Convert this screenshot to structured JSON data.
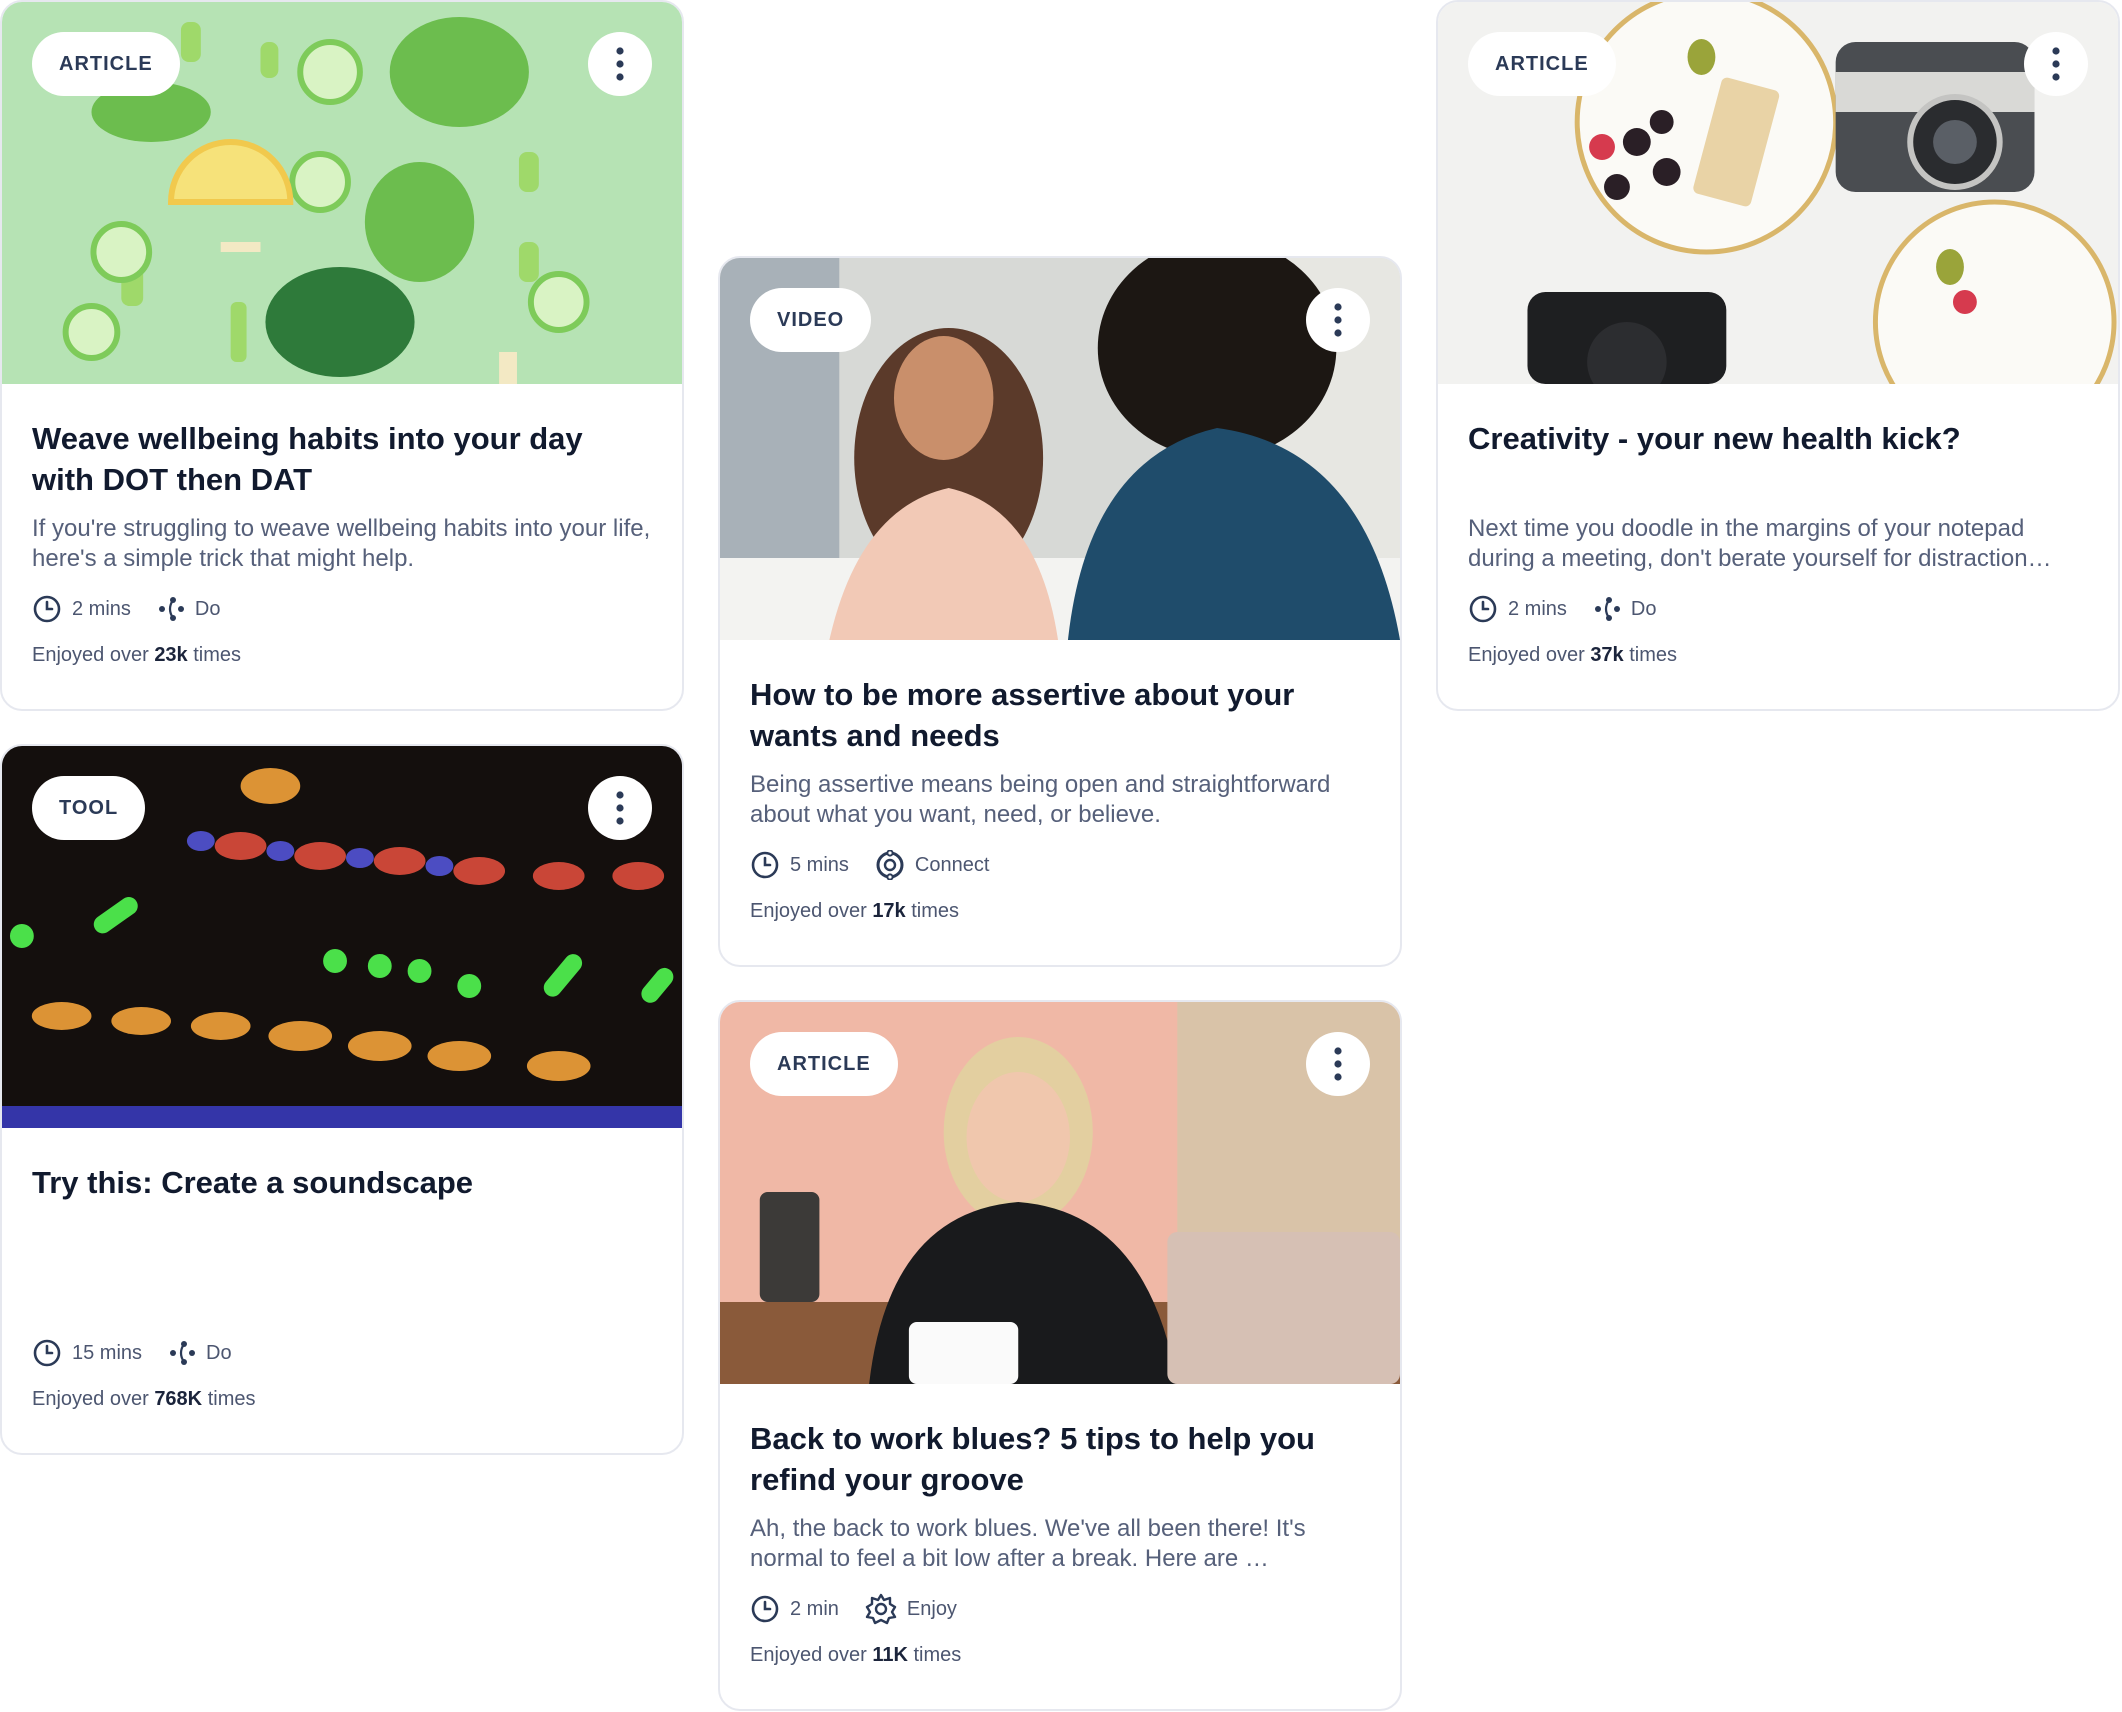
{
  "cards": [
    {
      "badge": "ARTICLE",
      "title": "Weave wellbeing habits into your day with DOT then DAT",
      "description": "If you're struggling to weave wellbeing habits into your life, here's a simple trick that might help.",
      "duration": "2 mins",
      "category": "Do",
      "category_icon": "do-icon",
      "enjoyed_prefix": "Enjoyed over",
      "enjoyed_count": "23k",
      "enjoyed_suffix": "times"
    },
    {
      "badge": "VIDEO",
      "title": "How to be more assertive about your wants and needs",
      "description": "Being assertive means being open and straightforward about what you want, need, or believe.",
      "duration": "5 mins",
      "category": "Connect",
      "category_icon": "connect-icon",
      "enjoyed_prefix": "Enjoyed over",
      "enjoyed_count": "17k",
      "enjoyed_suffix": "times"
    },
    {
      "badge": "ARTICLE",
      "title": "Creativity - your new health kick?",
      "description": "Next time you doodle in the margins of your notepad during a meeting, don't berate yourself for distraction…",
      "duration": "2 mins",
      "category": "Do",
      "category_icon": "do-icon",
      "enjoyed_prefix": "Enjoyed over",
      "enjoyed_count": "37k",
      "enjoyed_suffix": "times"
    },
    {
      "badge": "TOOL",
      "title": "Try this: Create a soundscape",
      "description": "",
      "duration": "15 mins",
      "category": "Do",
      "category_icon": "do-icon",
      "enjoyed_prefix": "Enjoyed over",
      "enjoyed_count": "768K",
      "enjoyed_suffix": "times"
    },
    {
      "badge": "ARTICLE",
      "title": "Back to work blues? 5 tips to help you refind your groove",
      "description": "Ah, the back to work blues. We've all been there! It's normal to feel a bit low after a break. Here are …",
      "duration": "2 min",
      "category": "Enjoy",
      "category_icon": "enjoy-icon",
      "enjoyed_prefix": "Enjoyed over",
      "enjoyed_count": "11K",
      "enjoyed_suffix": "times"
    }
  ],
  "colors": {
    "card_border": "#e6e8ef",
    "title_text": "#111a2e",
    "body_text": "#56607a",
    "meta_text": "#4c5670"
  }
}
